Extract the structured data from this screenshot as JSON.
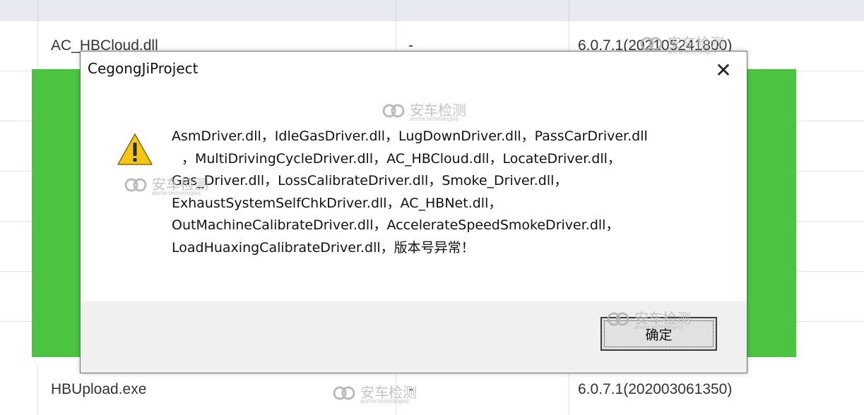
{
  "table": {
    "rows": [
      {
        "name": "AC_HBCloud.dll",
        "status": "-",
        "version": "6.0.7.1(202105241800)"
      },
      {
        "name": "HBUpload.exe",
        "status": "-",
        "version": "6.0.7.1(202003061350)"
      }
    ]
  },
  "dialog": {
    "title": "CegongJiProject",
    "close_glyph": "✕",
    "icon": "warning-icon",
    "message_lines": [
      "AsmDriver.dll，IdleGasDriver.dll，LugDownDriver.dll，PassCarDriver.dll",
      "，MultiDrivingCycleDriver.dll，AC_HBCloud.dll，LocateDriver.dll，",
      "Gas_Driver.dll，LossCalibrateDriver.dll，Smoke_Driver.dll，",
      "ExhaustSystemSelfChkDriver.dll，AC_HBNet.dll，",
      "OutMachineCalibrateDriver.dll，AccelerateSpeedSmokeDriver.dll，",
      "LoadHuaxingCalibrateDriver.dll，版本号异常！"
    ],
    "ok_label": "确定"
  },
  "watermark": {
    "text": "安车检测",
    "subtext": "anche technologies"
  },
  "colors": {
    "green": "#4cc442",
    "warning_yellow": "#f5c518"
  }
}
